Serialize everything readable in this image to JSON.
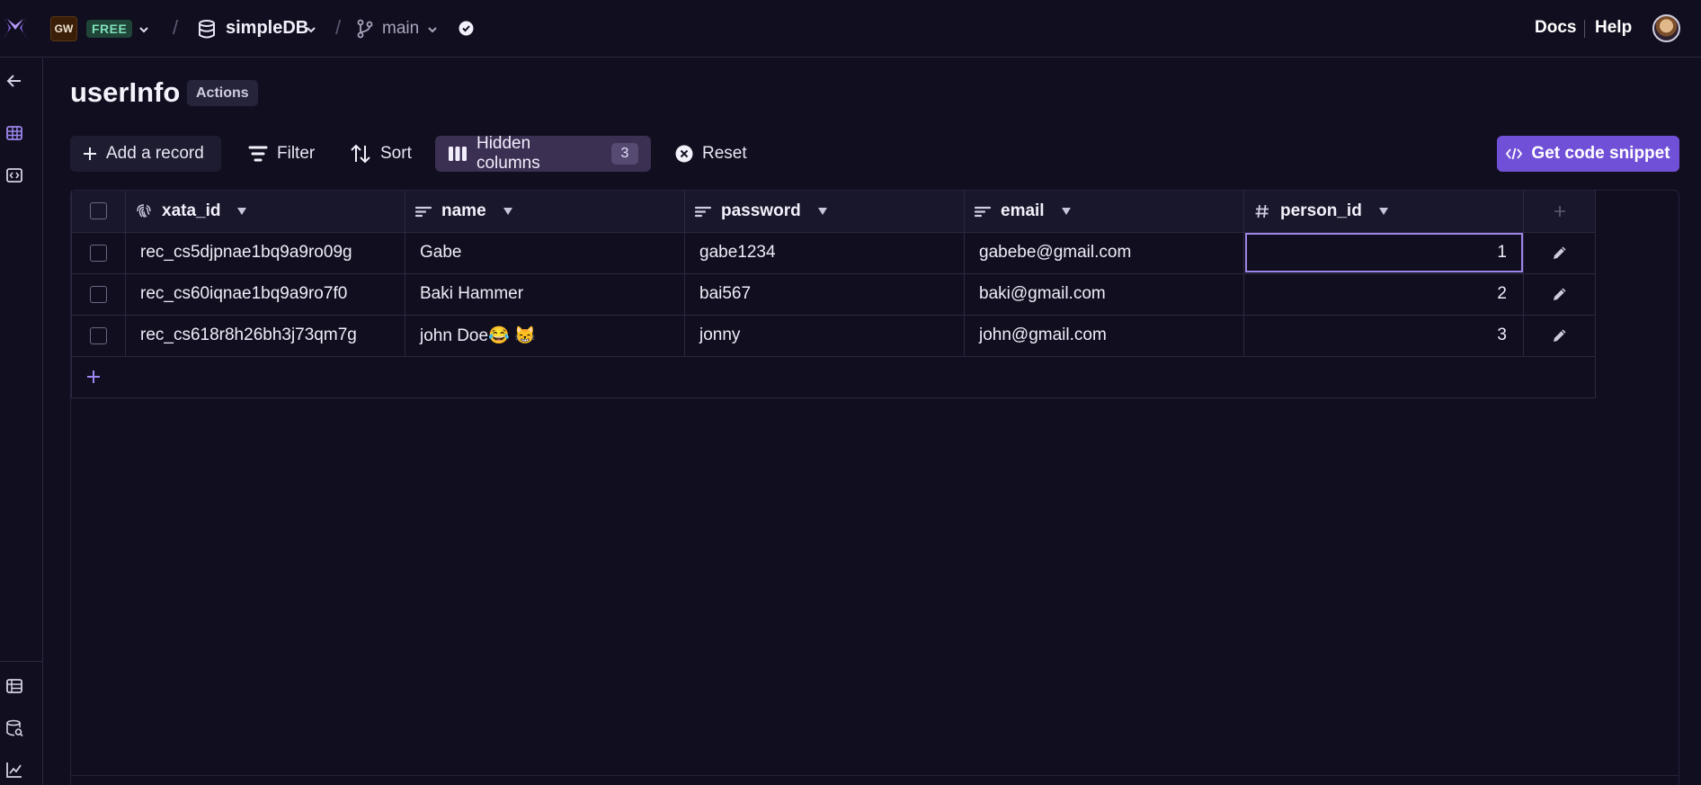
{
  "topbar": {
    "workspace_initials": "GW",
    "plan": "FREE",
    "database": "simpleDB",
    "branch": "main",
    "breadcrumb_sep": "/",
    "docs": "Docs",
    "help": "Help"
  },
  "page": {
    "title": "userInfo",
    "actions_label": "Actions"
  },
  "toolbar": {
    "add_record": "Add a record",
    "filter": "Filter",
    "sort": "Sort",
    "hidden_columns": "Hidden columns",
    "hidden_count": "3",
    "reset": "Reset",
    "code_snippet": "Get code snippet"
  },
  "table": {
    "columns": [
      {
        "name": "xata_id",
        "type_icon": "fingerprint-icon"
      },
      {
        "name": "name",
        "type_icon": "text-type-icon"
      },
      {
        "name": "password",
        "type_icon": "text-type-icon"
      },
      {
        "name": "email",
        "type_icon": "text-type-icon"
      },
      {
        "name": "person_id",
        "type_icon": "hash-icon"
      }
    ],
    "rows": [
      {
        "xata_id": "rec_cs5djpnae1bq9a9ro09g",
        "name": "Gabe",
        "password": "gabe1234",
        "email": "gabebe@gmail.com",
        "person_id": "1"
      },
      {
        "xata_id": "rec_cs60iqnae1bq9a9ro7f0",
        "name": "Baki Hammer",
        "password": "bai567",
        "email": "baki@gmail.com",
        "person_id": "2"
      },
      {
        "xata_id": "rec_cs618r8h26bh3j73qm7g",
        "name": "john Doe😂 😸",
        "password": "jonny",
        "email": "john@gmail.com",
        "person_id": "3"
      }
    ]
  },
  "colors": {
    "background": "#110f1f",
    "accent": "#7150d8",
    "selected_cell": "#9b85e8"
  }
}
